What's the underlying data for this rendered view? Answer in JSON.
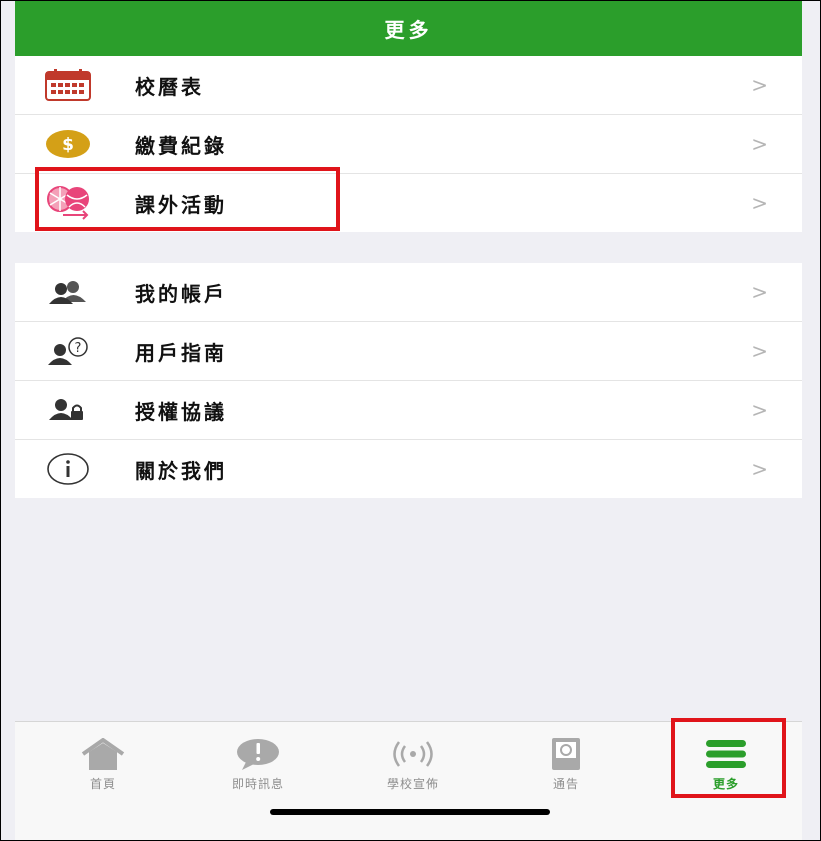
{
  "header": {
    "title": "更多"
  },
  "menu_group_1": [
    {
      "label": "校曆表",
      "icon": "calendar-icon"
    },
    {
      "label": "繳費紀錄",
      "icon": "dollar-coin-icon"
    },
    {
      "label": "課外活動",
      "icon": "sports-balls-icon"
    }
  ],
  "menu_group_2": [
    {
      "label": "我的帳戶",
      "icon": "users-icon"
    },
    {
      "label": "用戶指南",
      "icon": "user-question-icon"
    },
    {
      "label": "授權協議",
      "icon": "user-lock-icon"
    },
    {
      "label": "關於我們",
      "icon": "info-icon"
    }
  ],
  "chevron": ">",
  "tabs": [
    {
      "label": "首頁",
      "icon": "home-icon",
      "active": false
    },
    {
      "label": "即時訊息",
      "icon": "chat-alert-icon",
      "active": false
    },
    {
      "label": "學校宣佈",
      "icon": "broadcast-icon",
      "active": false
    },
    {
      "label": "通告",
      "icon": "notice-icon",
      "active": false
    },
    {
      "label": "更多",
      "icon": "menu-icon",
      "active": true
    }
  ],
  "colors": {
    "header_green": "#2b9e2b",
    "active_tab": "#2b9e2b",
    "highlight_red": "#e0141a",
    "calendar_red": "#c0392b",
    "coin_gold": "#d4a017",
    "activity_pink": "#e8457a"
  }
}
